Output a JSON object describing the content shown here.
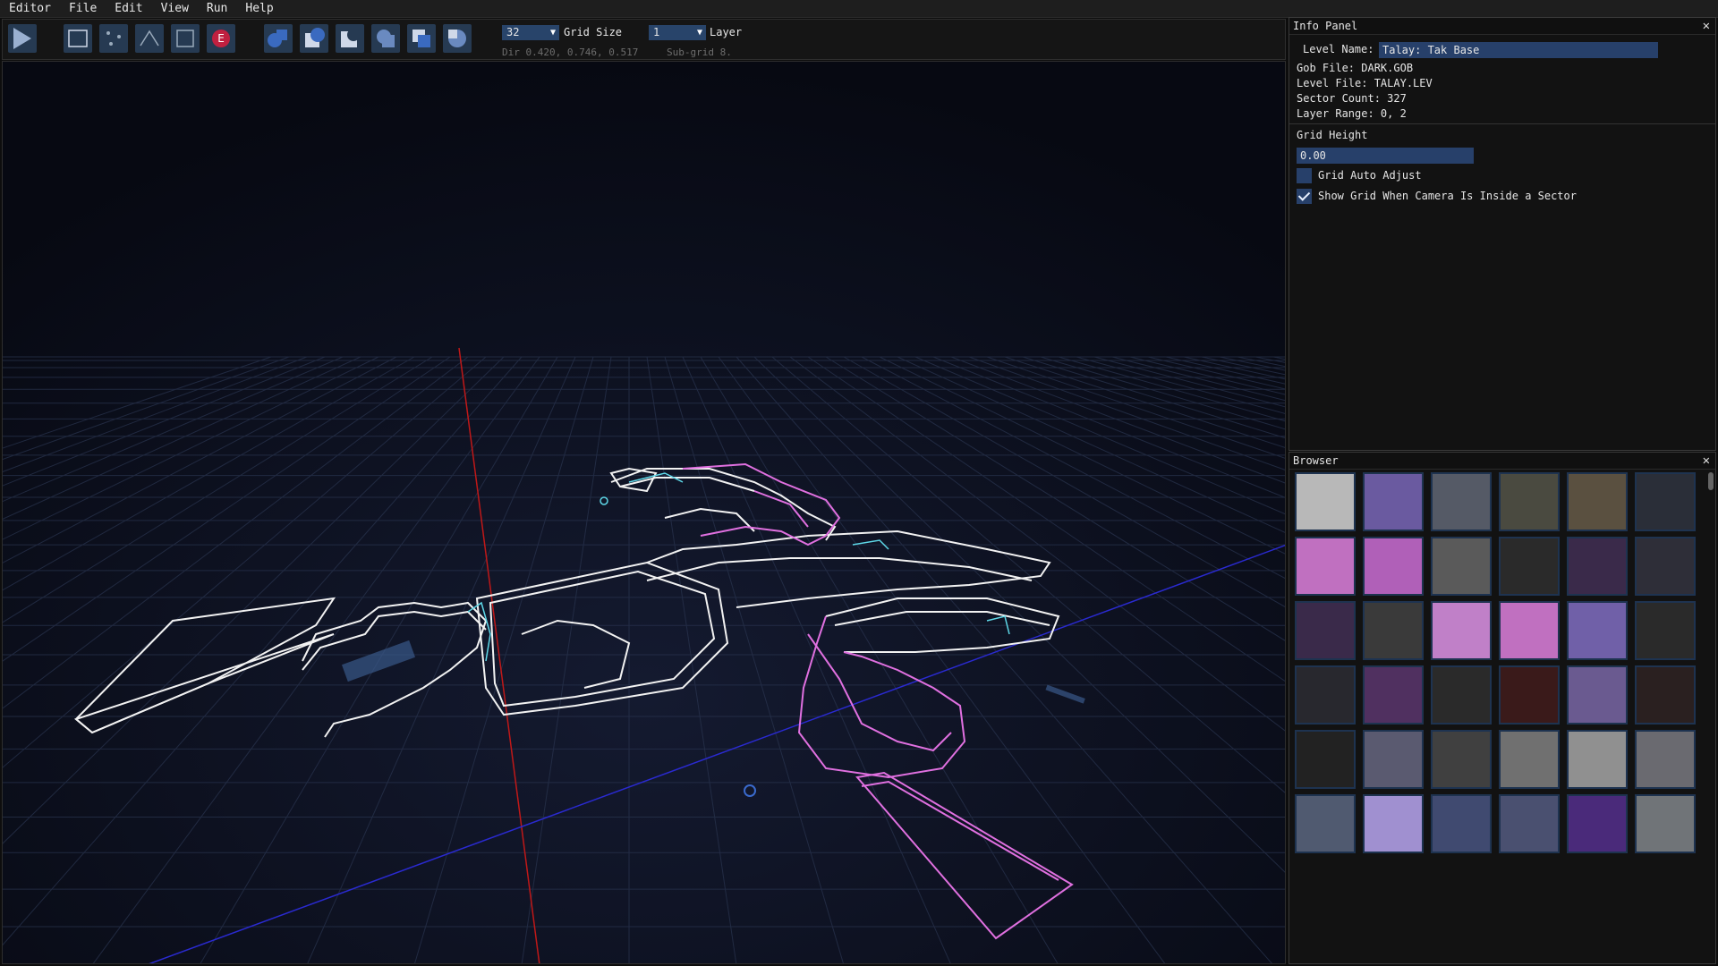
{
  "menu": [
    "Editor",
    "File",
    "Edit",
    "View",
    "Run",
    "Help"
  ],
  "toolbar": {
    "grid_size_value": "32",
    "grid_size_label": "Grid Size",
    "layer_value": "1",
    "layer_label": "Layer",
    "dir_text": "Dir 0.420, 0.746, 0.517",
    "subgrid_text": "Sub-grid 8.",
    "icons": [
      "play-icon",
      "select-rect-icon",
      "vertex-mode-icon",
      "wall-mode-icon",
      "sector-mode-icon",
      "entity-mode-icon",
      "csg-union-icon",
      "csg-subtract-icon",
      "csg-intersect-icon",
      "csg-merge-icon",
      "csg-xor-icon",
      "csg-split-icon"
    ]
  },
  "info_panel": {
    "title": "Info Panel",
    "level_name_label": "Level Name:",
    "level_name_value": "Talay: Tak Base",
    "gob_file": "Gob File: DARK.GOB",
    "level_file": "Level File: TALAY.LEV",
    "sector_count": "Sector Count: 327",
    "layer_range": "Layer Range: 0, 2",
    "grid_height_label": "Grid Height",
    "grid_height_value": "0.00",
    "grid_auto_adjust_label": "Grid Auto Adjust",
    "grid_auto_adjust_checked": false,
    "show_grid_label": "Show Grid When Camera Is Inside a Sector",
    "show_grid_checked": true
  },
  "browser": {
    "title": "Browser",
    "textures": [
      {
        "name": "tex-round-emblem",
        "color": "#b8b8b8"
      },
      {
        "name": "tex-purple-ring",
        "color": "#6a5aa0"
      },
      {
        "name": "tex-metal-x",
        "color": "#555a66"
      },
      {
        "name": "tex-hazard-door",
        "color": "#4a4a40"
      },
      {
        "name": "tex-brown-door",
        "color": "#5a5040"
      },
      {
        "name": "tex-dark-strip",
        "color": "#2a2e38"
      },
      {
        "name": "tex-pink-panel",
        "color": "#c070c0"
      },
      {
        "name": "tex-pink-vertical",
        "color": "#b060b8"
      },
      {
        "name": "tex-red-lights",
        "color": "#5a5a5a"
      },
      {
        "name": "tex-dark-band",
        "color": "#2a2a2a"
      },
      {
        "name": "tex-diag-purple",
        "color": "#3a2a4a"
      },
      {
        "name": "tex-diag-dark",
        "color": "#2e2e38"
      },
      {
        "name": "tex-diag-purple-2",
        "color": "#3a2a4a"
      },
      {
        "name": "tex-gray-grid",
        "color": "#3a3a3a"
      },
      {
        "name": "tex-pink-noise",
        "color": "#c080c8"
      },
      {
        "name": "tex-pink-maze",
        "color": "#c070c0"
      },
      {
        "name": "tex-purple-lattice",
        "color": "#7060a8"
      },
      {
        "name": "tex-dark-tubes",
        "color": "#2a2a2a"
      },
      {
        "name": "tex-circuit",
        "color": "#28282e"
      },
      {
        "name": "tex-purple-bars",
        "color": "#503060"
      },
      {
        "name": "tex-dark-dots",
        "color": "#2a2a2a"
      },
      {
        "name": "tex-red-dots",
        "color": "#3a1a1a"
      },
      {
        "name": "tex-purple-machine",
        "color": "#6a5a90"
      },
      {
        "name": "tex-red-strip",
        "color": "#2a2020"
      },
      {
        "name": "tex-red-stack",
        "color": "#222"
      },
      {
        "name": "tex-pink-frame",
        "color": "#5a5a70"
      },
      {
        "name": "tex-gray-machine",
        "color": "#404040"
      },
      {
        "name": "tex-gray-gradient",
        "color": "#707070"
      },
      {
        "name": "tex-light-door",
        "color": "#909090"
      },
      {
        "name": "tex-gray-noise",
        "color": "#6a6a70"
      },
      {
        "name": "tex-blue-rock",
        "color": "#505a70"
      },
      {
        "name": "tex-pink-blocks",
        "color": "#a090d0"
      },
      {
        "name": "tex-blue-rings",
        "color": "#404a70"
      },
      {
        "name": "tex-blue-cross",
        "color": "#4a5070"
      },
      {
        "name": "tex-violet-noise",
        "color": "#4a2a7a"
      },
      {
        "name": "tex-gray-door",
        "color": "#707478"
      }
    ]
  }
}
